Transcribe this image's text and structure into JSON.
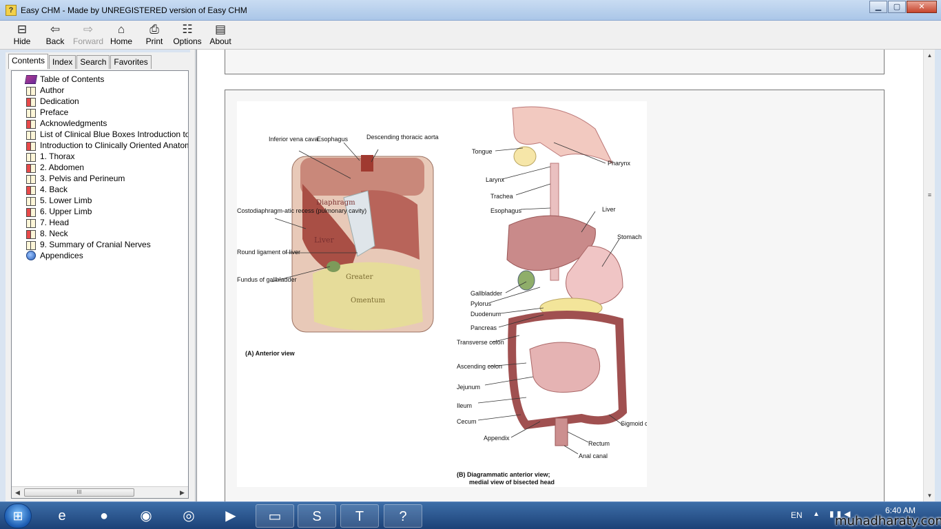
{
  "window": {
    "title": "Easy CHM - Made by UNREGISTERED version of Easy CHM",
    "icon": "help-question-icon",
    "controls": {
      "minimize": "▁",
      "maximize": "▢",
      "close": "✕"
    }
  },
  "toolbar": {
    "items": [
      {
        "label": "Hide",
        "icon": "hide-pane-icon",
        "glyph": "⊟",
        "enabled": true
      },
      {
        "label": "Back",
        "icon": "back-arrow-icon",
        "glyph": "⇦",
        "enabled": true
      },
      {
        "label": "Forward",
        "icon": "forward-arrow-icon",
        "glyph": "⇨",
        "enabled": false
      },
      {
        "label": "Home",
        "icon": "home-icon",
        "glyph": "⌂",
        "enabled": true
      },
      {
        "label": "Print",
        "icon": "printer-icon",
        "glyph": "⎙",
        "enabled": true
      },
      {
        "label": "Options",
        "icon": "options-icon",
        "glyph": "☷",
        "enabled": true
      },
      {
        "label": "About",
        "icon": "about-icon",
        "glyph": "▤",
        "enabled": true
      }
    ]
  },
  "nav": {
    "tabs": [
      "Contents",
      "Index",
      "Search",
      "Favorites"
    ],
    "active_tab": "Contents",
    "tree": [
      {
        "label": "Table of Contents",
        "icon": "toc-book-icon"
      },
      {
        "label": "Author",
        "icon": "book-icon"
      },
      {
        "label": "Dedication",
        "icon": "book-red-icon"
      },
      {
        "label": "Preface",
        "icon": "book-icon"
      },
      {
        "label": "Acknowledgments",
        "icon": "book-red-icon"
      },
      {
        "label": "List of Clinical Blue Boxes Introduction to Cli",
        "icon": "book-icon"
      },
      {
        "label": "Introduction to Clinically Oriented Anatomy",
        "icon": "book-red-icon"
      },
      {
        "label": "1. Thorax",
        "icon": "book-icon"
      },
      {
        "label": "2. Abdomen",
        "icon": "book-red-icon"
      },
      {
        "label": "3. Pelvis and Perineum",
        "icon": "book-icon"
      },
      {
        "label": "4. Back",
        "icon": "book-red-icon"
      },
      {
        "label": "5. Lower Limb",
        "icon": "book-icon"
      },
      {
        "label": "6. Upper Limb",
        "icon": "book-red-icon"
      },
      {
        "label": "7. Head",
        "icon": "book-icon"
      },
      {
        "label": "8. Neck",
        "icon": "book-red-icon"
      },
      {
        "label": "9. Summary of Cranial Nerves",
        "icon": "book-icon"
      },
      {
        "label": "Appendices",
        "icon": "app-globe-icon"
      }
    ],
    "scroll_grip": "III"
  },
  "figure": {
    "panel_a": {
      "caption": "(A) Anterior view",
      "labels": [
        "Inferior vena cava",
        "Esophagus",
        "Descending thoracic aorta",
        "Costodiaphragm-atic recess (pulmonary cavity)",
        "Round ligament of liver",
        "Fundus of gallbladder"
      ],
      "organ_labels": [
        "Diaphragm",
        "Liver",
        "Greater",
        "Omentum"
      ]
    },
    "panel_b": {
      "caption_line1": "(B) Diagrammatic anterior view;",
      "caption_line2": "medial view of bisected head",
      "labels": [
        "Tongue",
        "Pharynx",
        "Larynx",
        "Trachea",
        "Esophagus",
        "Liver",
        "Stomach",
        "Gallbladder",
        "Pylorus",
        "Duodenum",
        "Pancreas",
        "Transverse colon",
        "Ascending colon",
        "Jejunum",
        "Ileum",
        "Cecum",
        "Appendix",
        "Sigmoid colon",
        "Rectum",
        "Anal canal"
      ]
    }
  },
  "taskbar": {
    "start_icon": "windows-start-icon",
    "items": [
      {
        "icon": "internet-explorer-icon",
        "glyph": "e"
      },
      {
        "icon": "orange-app-icon",
        "glyph": "●"
      },
      {
        "icon": "firefox-icon",
        "glyph": "◉"
      },
      {
        "icon": "chrome-icon",
        "glyph": "◎"
      },
      {
        "icon": "media-player-icon",
        "glyph": "▶"
      },
      {
        "icon": "file-explorer-icon",
        "glyph": "▭"
      },
      {
        "icon": "skype-icon",
        "glyph": "S"
      },
      {
        "icon": "t-app-icon",
        "glyph": "T"
      },
      {
        "icon": "help-chm-icon",
        "glyph": "?"
      }
    ],
    "language": "EN",
    "time": "6:40 AM",
    "date": "",
    "watermark": "muhadharaty.com"
  },
  "colors": {
    "accent": "#1c4177",
    "titlebar": "#aac6e8",
    "link_red": "#e84a4a"
  }
}
